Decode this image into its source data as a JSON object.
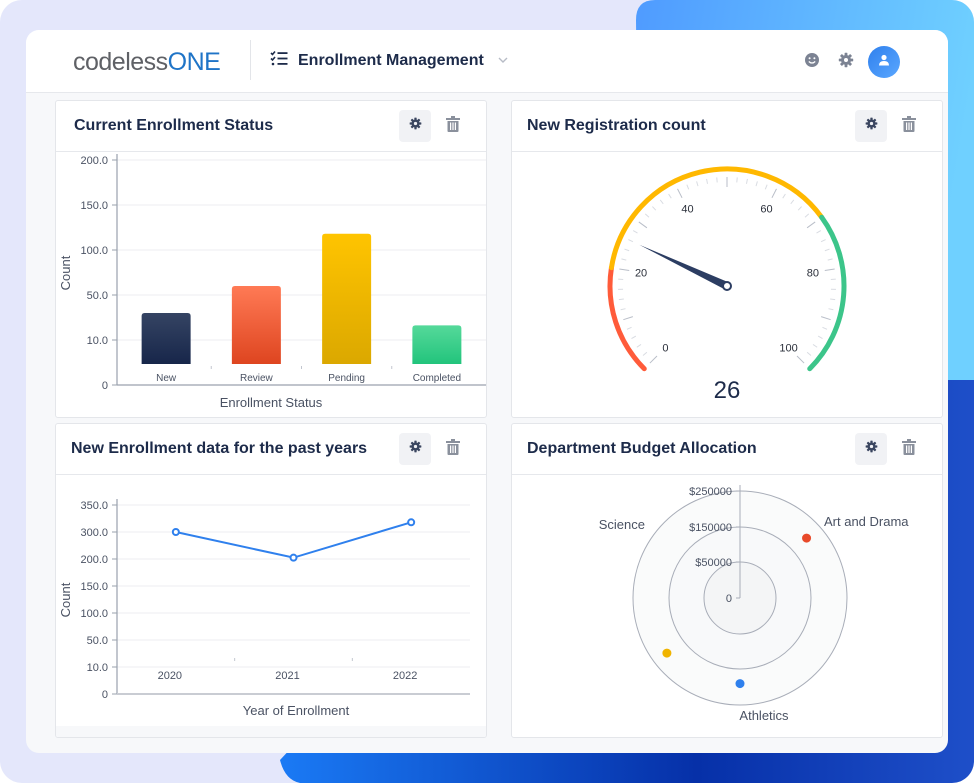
{
  "header": {
    "logo_main": "codeless",
    "logo_accent": "ONE",
    "app_name": "Enrollment Management",
    "icons": [
      "checklist-icon",
      "chevron-down-icon",
      "smiley-icon",
      "gear-icon",
      "user-icon"
    ]
  },
  "colors": {
    "brand_blue": "#1f74c7",
    "title_text": "#1d2b4a",
    "accent_blue": "#2f80ed"
  },
  "cards": {
    "enrollment_status": {
      "title": "Current Enrollment Status"
    },
    "registration": {
      "title": "New Registration count"
    },
    "past_years": {
      "title": "New Enrollment data for the past years"
    },
    "budget": {
      "title": "Department Budget Allocation"
    }
  },
  "chart_data": [
    {
      "id": "enrollment_status",
      "type": "bar",
      "title": "Current Enrollment Status",
      "xlabel": "Enrollment Status",
      "ylabel": "Count",
      "categories": [
        "New",
        "Review",
        "Pending",
        "Completed"
      ],
      "values": [
        34,
        60,
        118,
        23
      ],
      "colors": [
        [
          "#354463",
          "#17264a"
        ],
        [
          "#ff7a55",
          "#de4520"
        ],
        [
          "#ffc400",
          "#dba800"
        ],
        [
          "#55d99a",
          "#22c47c"
        ]
      ],
      "y_ticks": [
        "0",
        "10.0",
        "50.0",
        "100.0",
        "150.0",
        "200.0"
      ],
      "y_tick_values": [
        0,
        10,
        50,
        100,
        150,
        200
      ],
      "grid": true
    },
    {
      "id": "registration",
      "type": "gauge",
      "title": "New Registration count",
      "value": 26,
      "value_label": "26",
      "range": [
        0,
        100
      ],
      "tick_labels": [
        "0",
        "20",
        "40",
        "60",
        "80",
        "100"
      ],
      "bands": [
        {
          "from": 0,
          "to": 20,
          "color": "#ff5b3a"
        },
        {
          "from": 20,
          "to": 70,
          "color": "#ffb800"
        },
        {
          "from": 70,
          "to": 100,
          "color": "#3cc58a"
        }
      ],
      "needle_color": "#2c3d62"
    },
    {
      "id": "past_years",
      "type": "line",
      "title": "New Enrollment data for the past years",
      "xlabel": "Year of Enrollment",
      "ylabel": "Count",
      "x": [
        "2020",
        "2021",
        "2022"
      ],
      "series": [
        {
          "name": "Count",
          "values": [
            300,
            205,
            318
          ],
          "color": "#2f80ed"
        }
      ],
      "y_ticks": [
        "0",
        "10.0",
        "50.0",
        "100.0",
        "150.0",
        "200.0",
        "300.0",
        "350.0"
      ],
      "y_tick_values": [
        0,
        10,
        50,
        100,
        150,
        200,
        300,
        350
      ],
      "grid": true
    },
    {
      "id": "budget",
      "type": "radar",
      "title": "Department Budget Allocation",
      "categories": [
        "Art and Drama",
        "Athletics",
        "Science"
      ],
      "values": [
        225000,
        215000,
        230000
      ],
      "colors": [
        "#e84a2a",
        "#2f80ed",
        "#f0b400"
      ],
      "r_ticks": [
        "0",
        "$50000",
        "$150000",
        "$250000"
      ],
      "r_tick_values": [
        0,
        50000,
        150000,
        250000
      ]
    }
  ]
}
